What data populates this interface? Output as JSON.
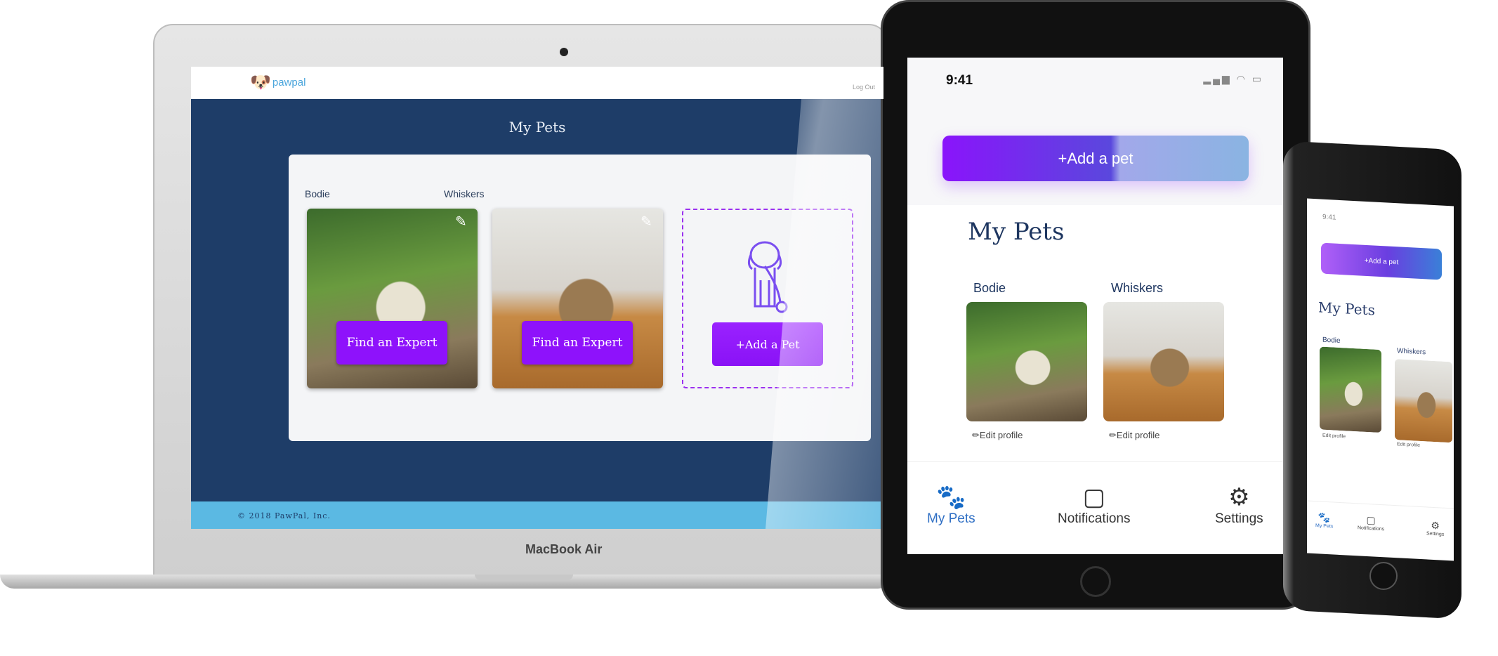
{
  "laptop": {
    "brand": "pawpal",
    "logout": "Log Out",
    "title": "My Pets",
    "pets": [
      {
        "name": "Bodie",
        "button": "Find an Expert"
      },
      {
        "name": "Whiskers",
        "button": "Find an Expert"
      }
    ],
    "add_pet": "+Add a Pet",
    "footer": "© 2018 PawPal, Inc.",
    "device_label": "MacBook Air"
  },
  "tablet": {
    "time": "9:41",
    "add_pet": "+Add a pet",
    "title": "My Pets",
    "pets": [
      {
        "name": "Bodie",
        "edit": "Edit profile"
      },
      {
        "name": "Whiskers",
        "edit": "Edit profile"
      }
    ],
    "tabs": [
      {
        "label": "My Pets",
        "icon": "paw-icon",
        "active": true
      },
      {
        "label": "Notifications",
        "icon": "notification-icon"
      },
      {
        "label": "Settings",
        "icon": "gear-icon"
      }
    ]
  },
  "phone": {
    "time": "9:41",
    "add_pet": "+Add a pet",
    "title": "My Pets",
    "pets": [
      {
        "name": "Bodie",
        "edit": "Edit profile"
      },
      {
        "name": "Whiskers",
        "edit": "Edit profile"
      }
    ],
    "tabs": [
      {
        "label": "My Pets"
      },
      {
        "label": "Notifications"
      },
      {
        "label": "Settings"
      }
    ]
  },
  "colors": {
    "primary": "#8e12fb",
    "navy": "#1e3d68",
    "footer": "#5bb9e3",
    "tab_active": "#2f6fc4"
  }
}
